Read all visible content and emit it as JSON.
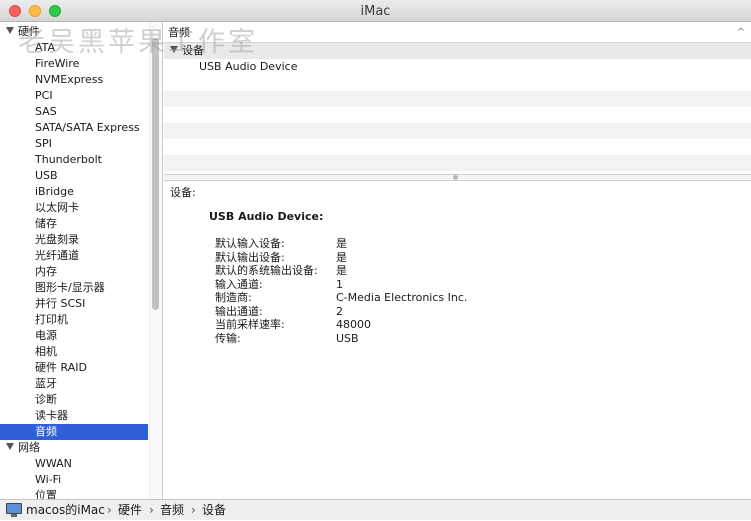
{
  "window": {
    "title": "iMac"
  },
  "watermark": "老吴黑苹果工作室",
  "sidebar": {
    "rows": [
      {
        "type": "group",
        "label": "硬件"
      },
      {
        "type": "item",
        "label": "ATA"
      },
      {
        "type": "item",
        "label": "FireWire"
      },
      {
        "type": "item",
        "label": "NVMExpress"
      },
      {
        "type": "item",
        "label": "PCI"
      },
      {
        "type": "item",
        "label": "SAS"
      },
      {
        "type": "item",
        "label": "SATA/SATA Express"
      },
      {
        "type": "item",
        "label": "SPI"
      },
      {
        "type": "item",
        "label": "Thunderbolt"
      },
      {
        "type": "item",
        "label": "USB"
      },
      {
        "type": "item",
        "label": "iBridge"
      },
      {
        "type": "item",
        "label": "以太网卡"
      },
      {
        "type": "item",
        "label": "储存"
      },
      {
        "type": "item",
        "label": "光盘刻录"
      },
      {
        "type": "item",
        "label": "光纤通道"
      },
      {
        "type": "item",
        "label": "内存"
      },
      {
        "type": "item",
        "label": "图形卡/显示器"
      },
      {
        "type": "item",
        "label": "并行 SCSI"
      },
      {
        "type": "item",
        "label": "打印机"
      },
      {
        "type": "item",
        "label": "电源"
      },
      {
        "type": "item",
        "label": "相机"
      },
      {
        "type": "item",
        "label": "硬件 RAID"
      },
      {
        "type": "item",
        "label": "蓝牙"
      },
      {
        "type": "item",
        "label": "诊断"
      },
      {
        "type": "item",
        "label": "读卡器"
      },
      {
        "type": "item",
        "label": "音频",
        "selected": true
      },
      {
        "type": "group",
        "label": "网络"
      },
      {
        "type": "item",
        "label": "WWAN"
      },
      {
        "type": "item",
        "label": "Wi-Fi"
      },
      {
        "type": "item",
        "label": "位置"
      }
    ]
  },
  "list": {
    "header": "音频",
    "group_label": "设备",
    "device": "USB Audio Device",
    "sort_indicator": "^"
  },
  "detail": {
    "section_title": "设备:",
    "device_name": "USB Audio Device:",
    "properties": [
      {
        "key": "默认输入设备:",
        "value": "是"
      },
      {
        "key": "默认输出设备:",
        "value": "是"
      },
      {
        "key": "默认的系统输出设备:",
        "value": "是"
      },
      {
        "key": "输入通道:",
        "value": "1"
      },
      {
        "key": "制造商:",
        "value": "C-Media Electronics Inc."
      },
      {
        "key": "输出通道:",
        "value": "2"
      },
      {
        "key": "当前采样速率:",
        "value": "48000"
      },
      {
        "key": "传输:",
        "value": "USB"
      }
    ]
  },
  "pathbar": {
    "crumbs": [
      "macos的iMac",
      "硬件",
      "音频",
      "设备"
    ],
    "separator": "›"
  }
}
